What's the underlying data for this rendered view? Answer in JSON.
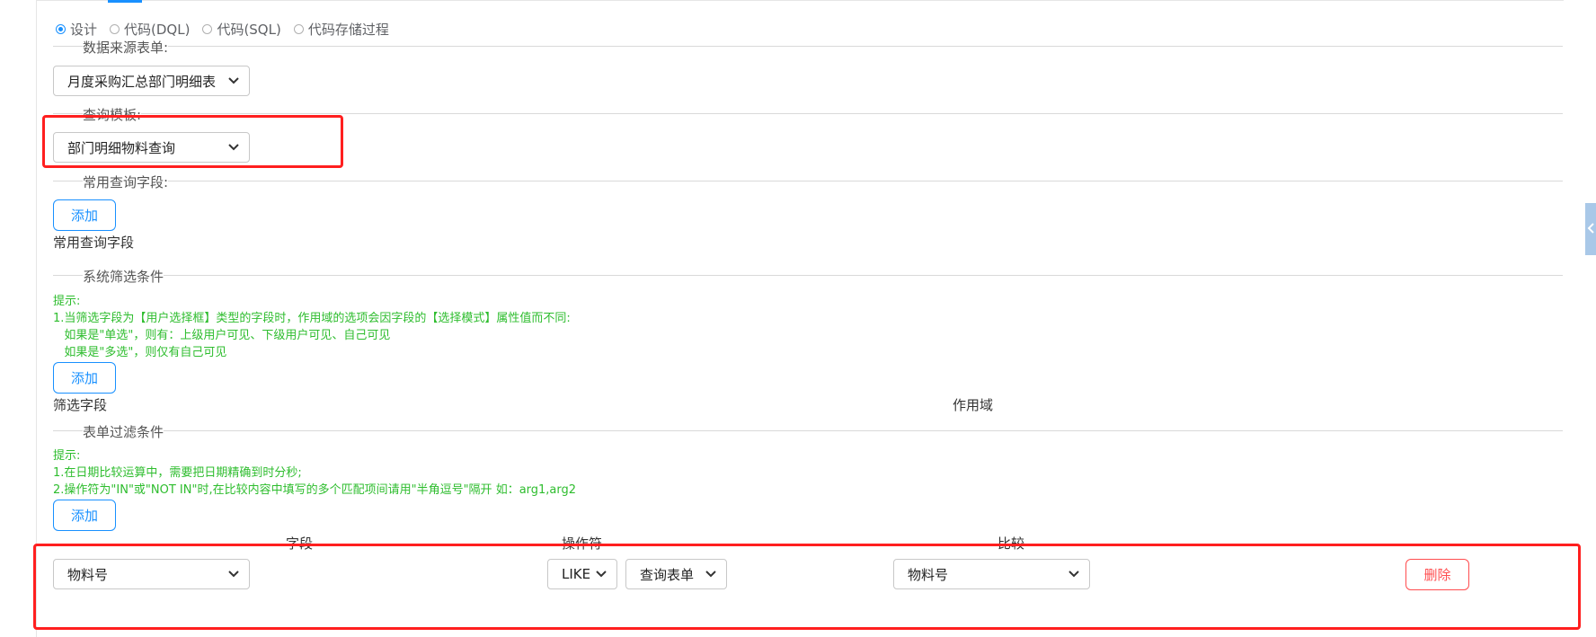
{
  "mode_options": [
    {
      "label": "设计",
      "checked": true
    },
    {
      "label": "代码(DQL)",
      "checked": false
    },
    {
      "label": "代码(SQL)",
      "checked": false
    },
    {
      "label": "代码存储过程",
      "checked": false
    }
  ],
  "datasource": {
    "title": "数据来源表单:",
    "selected": "月度采购汇总部门明细表"
  },
  "query_template": {
    "title": "查询模板:",
    "selected": "部门明细物料查询"
  },
  "common_fields": {
    "title": "常用查询字段:",
    "add_label": "添加",
    "list_label": "常用查询字段"
  },
  "system_filter": {
    "title": "系统筛选条件",
    "hint": "提示:\n1.当筛选字段为【用户选择框】类型的字段时，作用域的选项会因字段的【选择模式】属性值而不同:\n   如果是\"单选\"，则有：上级用户可见、下级用户可见、自己可见\n   如果是\"多选\"，则仅有自己可见",
    "add_label": "添加",
    "col_field": "筛选字段",
    "col_scope": "作用域"
  },
  "form_filter": {
    "title": "表单过滤条件",
    "hint": "提示:\n1.在日期比较运算中，需要把日期精确到时分秒;\n2.操作符为\"IN\"或\"NOT IN\"时,在比较内容中填写的多个匹配项间请用\"半角逗号\"隔开 如：arg1,arg2",
    "add_label": "添加",
    "col_field": "字段",
    "col_operator": "操作符",
    "col_compare": "比较",
    "row": {
      "field": "物料号",
      "operator": "LIKE",
      "source": "查询表单",
      "compare": "物料号",
      "delete_label": "删除"
    }
  },
  "colors": {
    "accent": "#1890ff",
    "hint_green": "#2ebd2e",
    "danger": "#ff4d4f",
    "highlight_red": "#ff1f1f"
  },
  "icons": {
    "select_arrow": "chevron-down-icon",
    "side_collapse": "chevron-left-icon"
  }
}
